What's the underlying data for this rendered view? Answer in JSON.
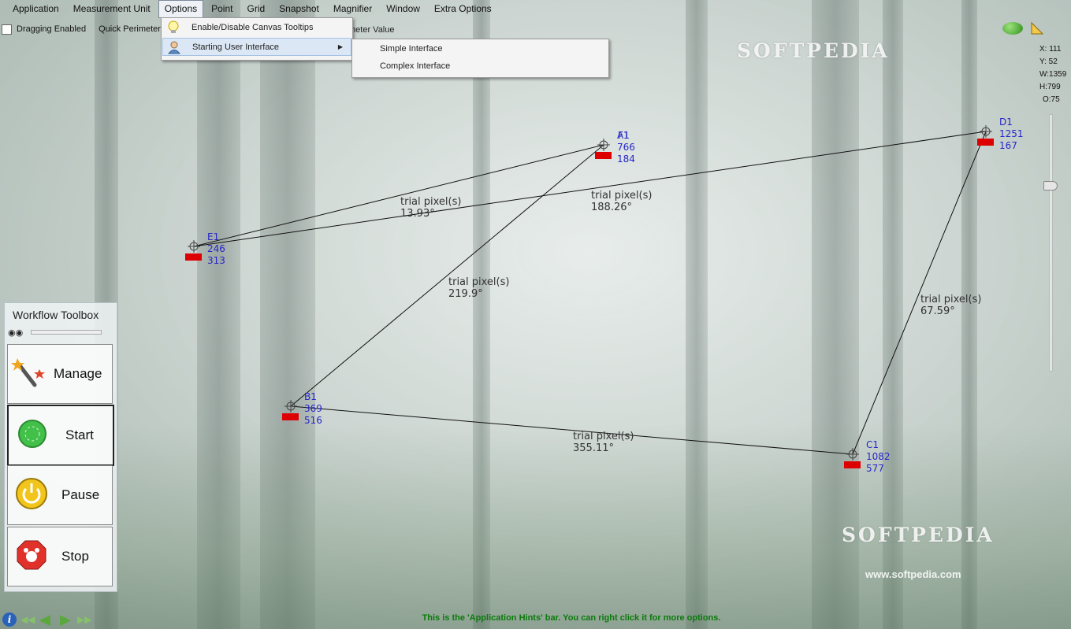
{
  "menubar": {
    "items": [
      "Application",
      "Measurement Unit",
      "Options",
      "Point",
      "Grid",
      "Snapshot",
      "Magnifier",
      "Window",
      "Extra Options"
    ],
    "active_index": 2
  },
  "toolbar": {
    "dragging_label": "Dragging Enabled",
    "quick_perimeter_label": "Quick Perimeter:",
    "parameter_value_label": "meter Value"
  },
  "options_menu": {
    "items": [
      {
        "label": "Enable/Disable Canvas Tooltips",
        "icon": "lightbulb-icon"
      },
      {
        "label": "Starting User Interface",
        "icon": "user-icon",
        "has_submenu": true
      }
    ]
  },
  "submenu": {
    "items": [
      "Simple Interface",
      "Complex Interface"
    ]
  },
  "status": {
    "x": "X: 111",
    "y": "Y: 52",
    "w": "W:1359",
    "h": "H:799",
    "o": "O:75"
  },
  "points": [
    {
      "name": "A1",
      "x": "766",
      "y": "184"
    },
    {
      "name": "B1",
      "x": "369",
      "y": "516"
    },
    {
      "name": "C1",
      "x": "1082",
      "y": "577"
    },
    {
      "name": "D1",
      "x": "1251",
      "y": "167"
    },
    {
      "name": "E1",
      "x": "246",
      "y": "313"
    },
    {
      "name": "F1",
      "x": "766",
      "y": "184"
    }
  ],
  "segments": [
    {
      "label": "trial pixel(s)",
      "angle": "13.93°"
    },
    {
      "label": "trial pixel(s)",
      "angle": "188.26°"
    },
    {
      "label": "trial pixel(s)",
      "angle": "219.9°"
    },
    {
      "label": "trial pixel(s)",
      "angle": "67.59°"
    },
    {
      "label": "trial pixel(s)",
      "angle": "355.11°"
    }
  ],
  "toolbox": {
    "title": "Workflow Toolbox",
    "buttons": [
      {
        "label": "Manage",
        "icon": "magic-wand-icon"
      },
      {
        "label": "Start",
        "icon": "start-icon"
      },
      {
        "label": "Pause",
        "icon": "pause-icon"
      },
      {
        "label": "Stop",
        "icon": "stop-icon"
      }
    ]
  },
  "watermark": {
    "brand": "SOFTPEDIA",
    "url": "www.softpedia.com"
  },
  "hints": {
    "text": "This is the 'Application Hints' bar. You can right click it for more options."
  }
}
